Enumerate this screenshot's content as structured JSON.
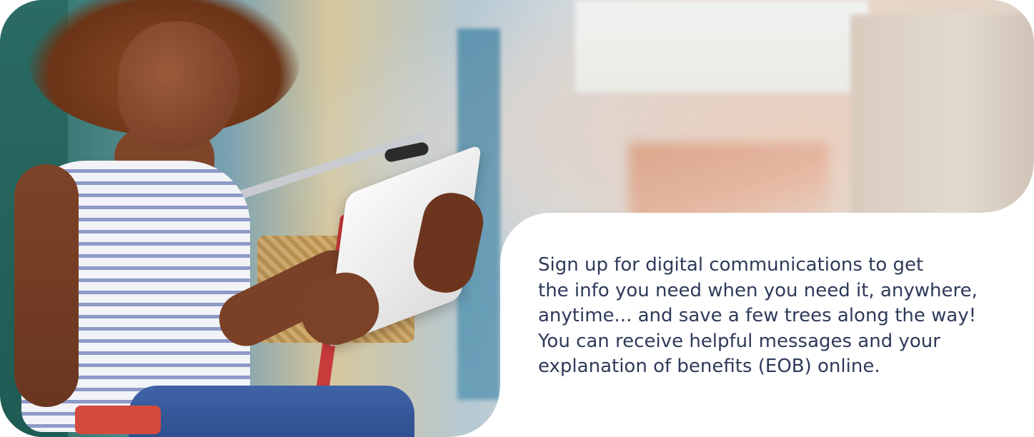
{
  "hero": {
    "image_alt": "Smiling woman with curly hair sitting by a bicycle on a city street, reading a tablet",
    "message": "Sign up for digital communications to get\nthe info you need when you need it, anywhere,\nanytime... and save a few trees along the way!\nYou can receive helpful messages and your\nexplanation of benefits (EOB) online.",
    "colors": {
      "text": "#2e3a59",
      "card_background": "#ffffff"
    }
  }
}
